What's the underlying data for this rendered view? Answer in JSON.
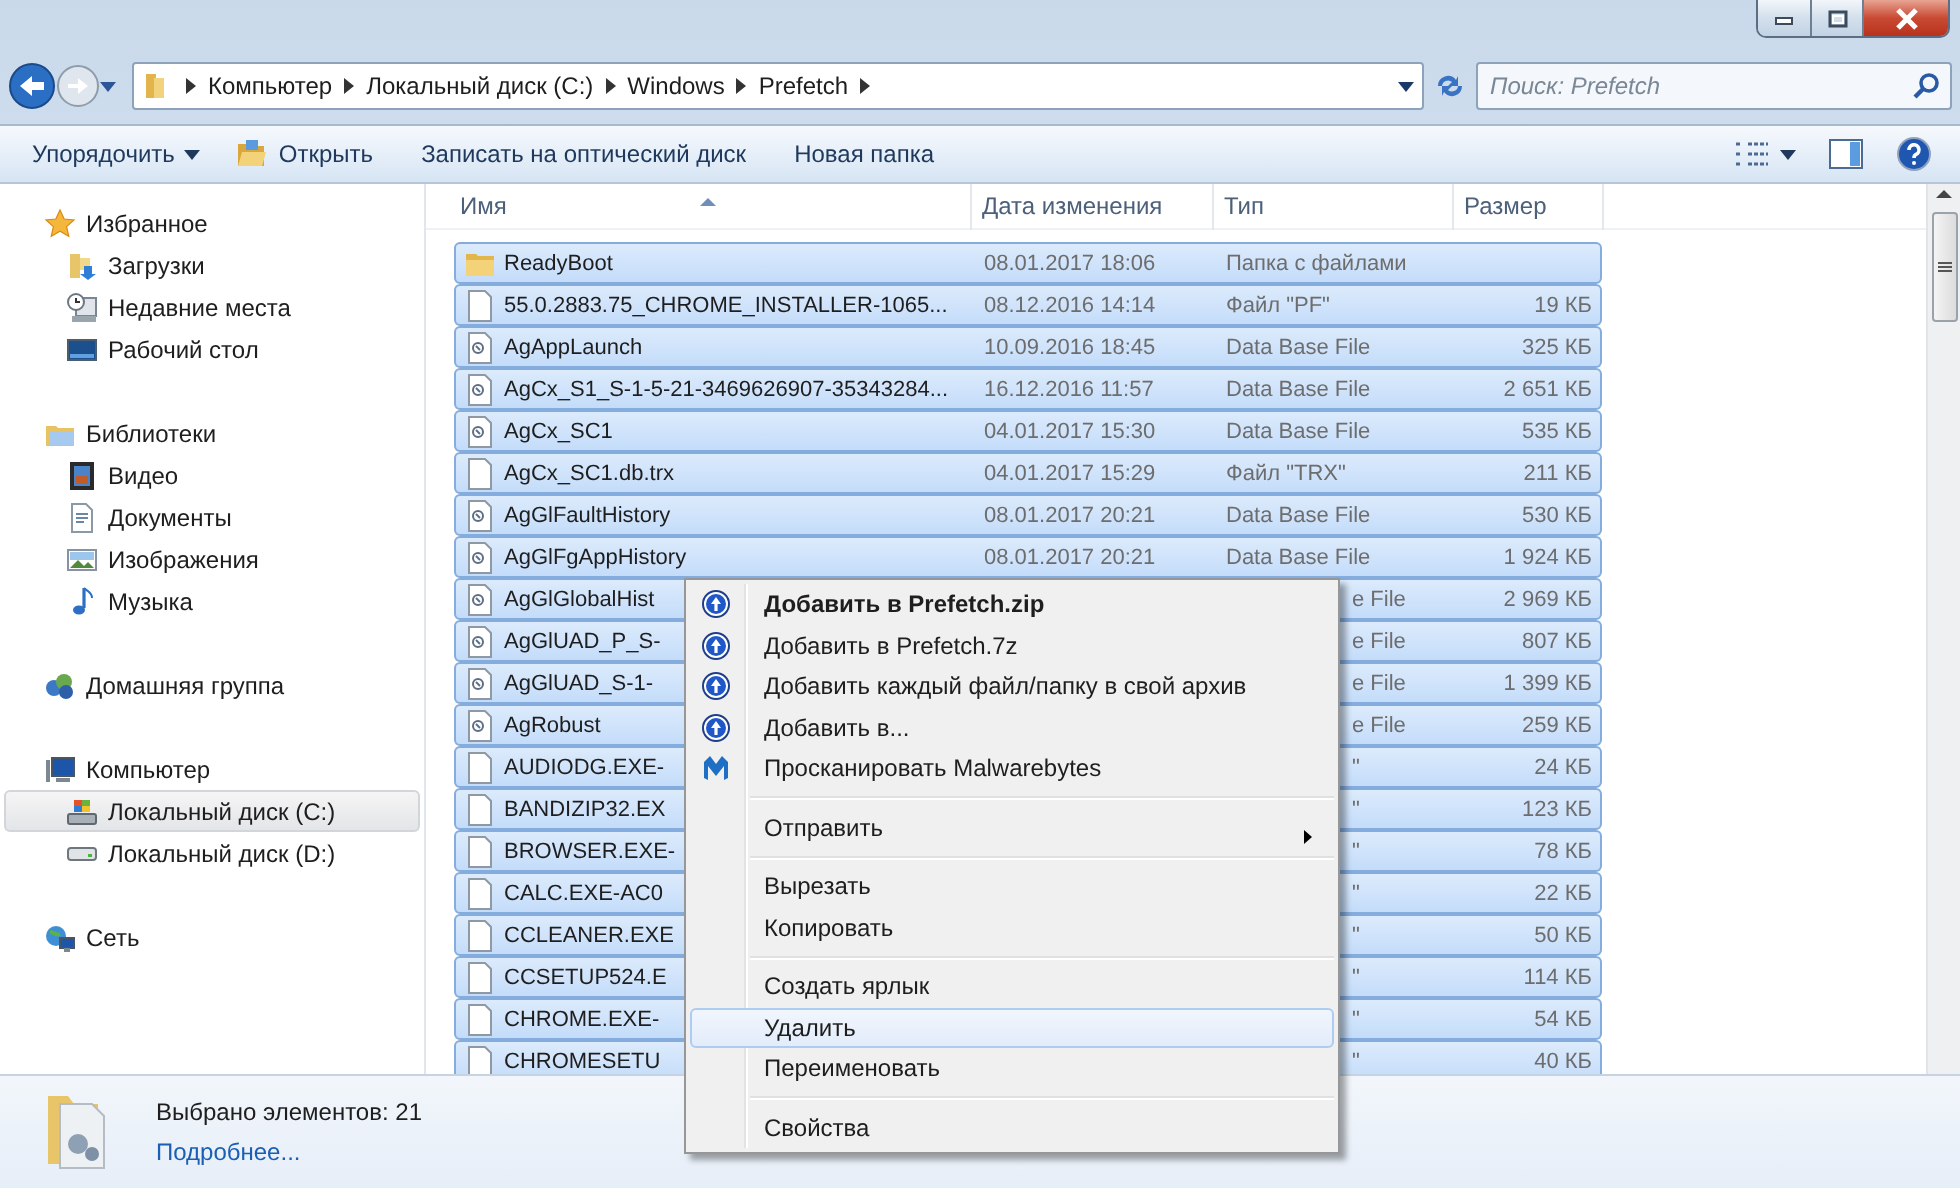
{
  "window": {
    "controls": [
      {
        "kind": "minimize"
      },
      {
        "kind": "maximize"
      },
      {
        "kind": "close"
      }
    ]
  },
  "address": {
    "crumbs": [
      "Компьютер",
      "Локальный диск (C:)",
      "Windows",
      "Prefetch"
    ],
    "search": {
      "placeholder": "Поиск: Prefetch"
    }
  },
  "toolbar": {
    "buttons": [
      {
        "label": "Упорядочить",
        "kind": "dropdown"
      },
      {
        "label": "Открыть",
        "kind": "open"
      },
      {
        "label": "Записать на оптический диск",
        "kind": "plain"
      },
      {
        "label": "Новая папка",
        "kind": "plain"
      }
    ]
  },
  "sidebar": {
    "groups": [
      {
        "label": "Избранное",
        "kind": "star",
        "selected": false,
        "children": [
          {
            "label": "Загрузки",
            "kind": "downloads",
            "selected": false
          },
          {
            "label": "Недавние места",
            "kind": "recent",
            "selected": false
          },
          {
            "label": "Рабочий стол",
            "kind": "desktop",
            "selected": false
          }
        ]
      },
      {
        "label": "Библиотеки",
        "kind": "library",
        "selected": false,
        "children": [
          {
            "label": "Видео",
            "kind": "video",
            "selected": false
          },
          {
            "label": "Документы",
            "kind": "documents",
            "selected": false
          },
          {
            "label": "Изображения",
            "kind": "images",
            "selected": false
          },
          {
            "label": "Музыка",
            "kind": "music",
            "selected": false
          }
        ]
      },
      {
        "label": "Домашняя группа",
        "kind": "homegroup",
        "selected": false
      },
      {
        "label": "Компьютер",
        "kind": "computer",
        "selected": false,
        "children": [
          {
            "label": "Локальный диск (C:)",
            "kind": "system-drive",
            "selected": true
          },
          {
            "label": "Локальный диск (D:)",
            "kind": "drive",
            "selected": false
          }
        ]
      },
      {
        "label": "Сеть",
        "kind": "network",
        "selected": false
      }
    ]
  },
  "files": {
    "columns": [
      "Имя",
      "Дата изменения",
      "Тип",
      "Размер"
    ],
    "rows": [
      {
        "kind": "folder",
        "name": "ReadyBoot",
        "date": "08.01.2017 18:06",
        "type": "Папка с файлами",
        "selected": true
      },
      {
        "kind": "file",
        "name": "55.0.2883.75_CHROME_INSTALLER-1065...",
        "date": "08.12.2016 14:14",
        "type": "Файл \"PF\"",
        "size": "19 КБ",
        "selected": true
      },
      {
        "kind": "database",
        "name": "AgAppLaunch",
        "date": "10.09.2016 18:45",
        "type": "Data Base File",
        "size": "325 КБ",
        "selected": true
      },
      {
        "kind": "database",
        "name": "AgCx_S1_S-1-5-21-3469626907-35343284...",
        "date": "16.12.2016 11:57",
        "type": "Data Base File",
        "size": "2 651 КБ",
        "selected": true
      },
      {
        "kind": "database",
        "name": "AgCx_SC1",
        "date": "04.01.2017 15:30",
        "type": "Data Base File",
        "size": "535 КБ",
        "selected": true
      },
      {
        "kind": "file",
        "name": "AgCx_SC1.db.trx",
        "date": "04.01.2017 15:29",
        "type": "Файл \"TRX\"",
        "size": "211 КБ",
        "selected": true
      },
      {
        "kind": "database",
        "name": "AgGlFaultHistory",
        "date": "08.01.2017 20:21",
        "type": "Data Base File",
        "size": "530 КБ",
        "selected": true
      },
      {
        "kind": "database",
        "name": "AgGlFgAppHistory",
        "date": "08.01.2017 20:21",
        "type": "Data Base File",
        "size": "1 924 КБ",
        "selected": true
      },
      {
        "kind": "database",
        "name": "AgGlGlobalHist",
        "type": "e File",
        "size": "2 969 КБ",
        "selected": true
      },
      {
        "kind": "database",
        "name": "AgGlUAD_P_S-",
        "type": "e File",
        "size": "807 КБ",
        "selected": true
      },
      {
        "kind": "database",
        "name": "AgGlUAD_S-1-",
        "type": "e File",
        "size": "1 399 КБ",
        "selected": true
      },
      {
        "kind": "database",
        "name": "AgRobust",
        "type": "e File",
        "size": "259 КБ",
        "selected": true
      },
      {
        "kind": "file",
        "name": "AUDIODG.EXE-",
        "type": "\"",
        "size": "24 КБ",
        "selected": true
      },
      {
        "kind": "file",
        "name": "BANDIZIP32.EX",
        "type": "\"",
        "size": "123 КБ",
        "selected": true
      },
      {
        "kind": "file",
        "name": "BROWSER.EXE-",
        "type": "\"",
        "size": "78 КБ",
        "selected": true
      },
      {
        "kind": "file",
        "name": "CALC.EXE-AC0",
        "type": "\"",
        "size": "22 КБ",
        "selected": true
      },
      {
        "kind": "file",
        "name": "CCLEANER.EXE",
        "type": "\"",
        "size": "50 КБ",
        "selected": true
      },
      {
        "kind": "file",
        "name": "CCSETUP524.E",
        "type": "\"",
        "size": "114 КБ",
        "selected": true
      },
      {
        "kind": "file",
        "name": "CHROME.EXE-",
        "type": "\"",
        "size": "54 КБ",
        "selected": true
      },
      {
        "kind": "file",
        "name": "CHROMESETU",
        "type": "\"",
        "size": "40 КБ",
        "selected": true
      }
    ]
  },
  "context_menu": {
    "items": [
      {
        "kind": "archive",
        "label": "Добавить в Prefetch.zip",
        "default": true,
        "selected": false
      },
      {
        "kind": "archive",
        "label": "Добавить в Prefetch.7z",
        "default": false,
        "selected": false
      },
      {
        "kind": "archive",
        "label": "Добавить каждый файл/папку в свой архив",
        "default": false,
        "selected": false
      },
      {
        "kind": "archive",
        "label": "Добавить в...",
        "default": false,
        "selected": false
      },
      {
        "kind": "scan",
        "label": "Просканировать Malwarebytes",
        "default": false,
        "selected": false
      },
      {
        "kind": "separator"
      },
      {
        "kind": "submenu",
        "label": "Отправить",
        "default": false,
        "selected": false
      },
      {
        "kind": "separator"
      },
      {
        "kind": "plain",
        "label": "Вырезать",
        "default": false,
        "selected": false
      },
      {
        "kind": "plain",
        "label": "Копировать",
        "default": false,
        "selected": false
      },
      {
        "kind": "separator"
      },
      {
        "kind": "plain",
        "label": "Создать ярлык",
        "default": false,
        "selected": false
      },
      {
        "kind": "plain",
        "label": "Удалить",
        "default": false,
        "selected": true
      },
      {
        "kind": "plain",
        "label": "Переименовать",
        "default": false,
        "selected": false
      },
      {
        "kind": "separator"
      },
      {
        "kind": "plain",
        "label": "Свойства",
        "default": false,
        "selected": false
      }
    ]
  },
  "details": {
    "summary": "Выбрано элементов: 21",
    "link": "Подробнее..."
  }
}
